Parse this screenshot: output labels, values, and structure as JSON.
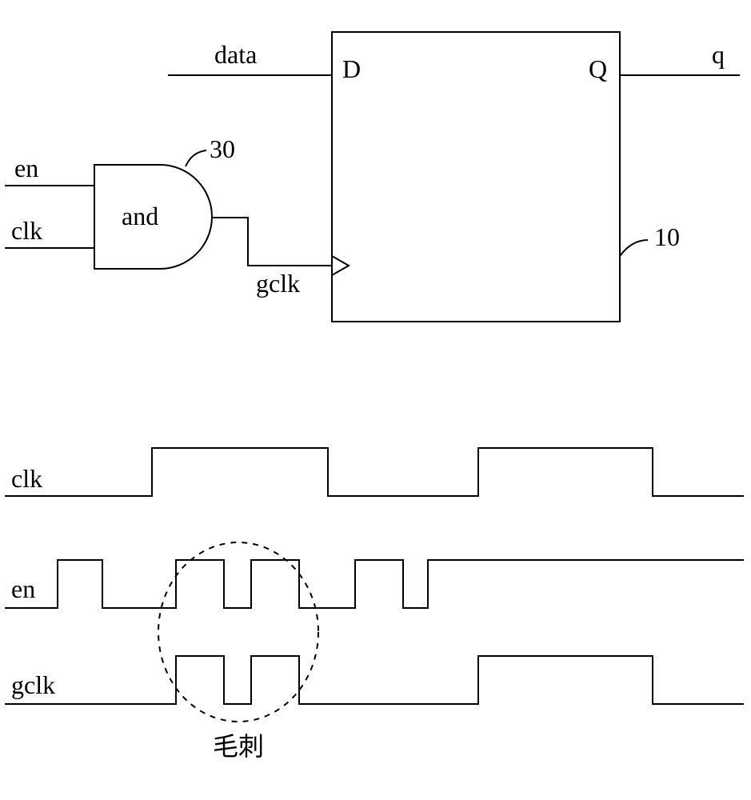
{
  "circuit": {
    "signals": {
      "data": "data",
      "en": "en",
      "clk": "clk",
      "gclk": "gclk",
      "q": "q"
    },
    "gate": {
      "label": "and",
      "ref": "30"
    },
    "flipflop": {
      "d": "D",
      "q": "Q",
      "ref": "10"
    }
  },
  "timing": {
    "rows": {
      "clk": "clk",
      "en": "en",
      "gclk": "gclk"
    },
    "annotation": "毛刺"
  }
}
